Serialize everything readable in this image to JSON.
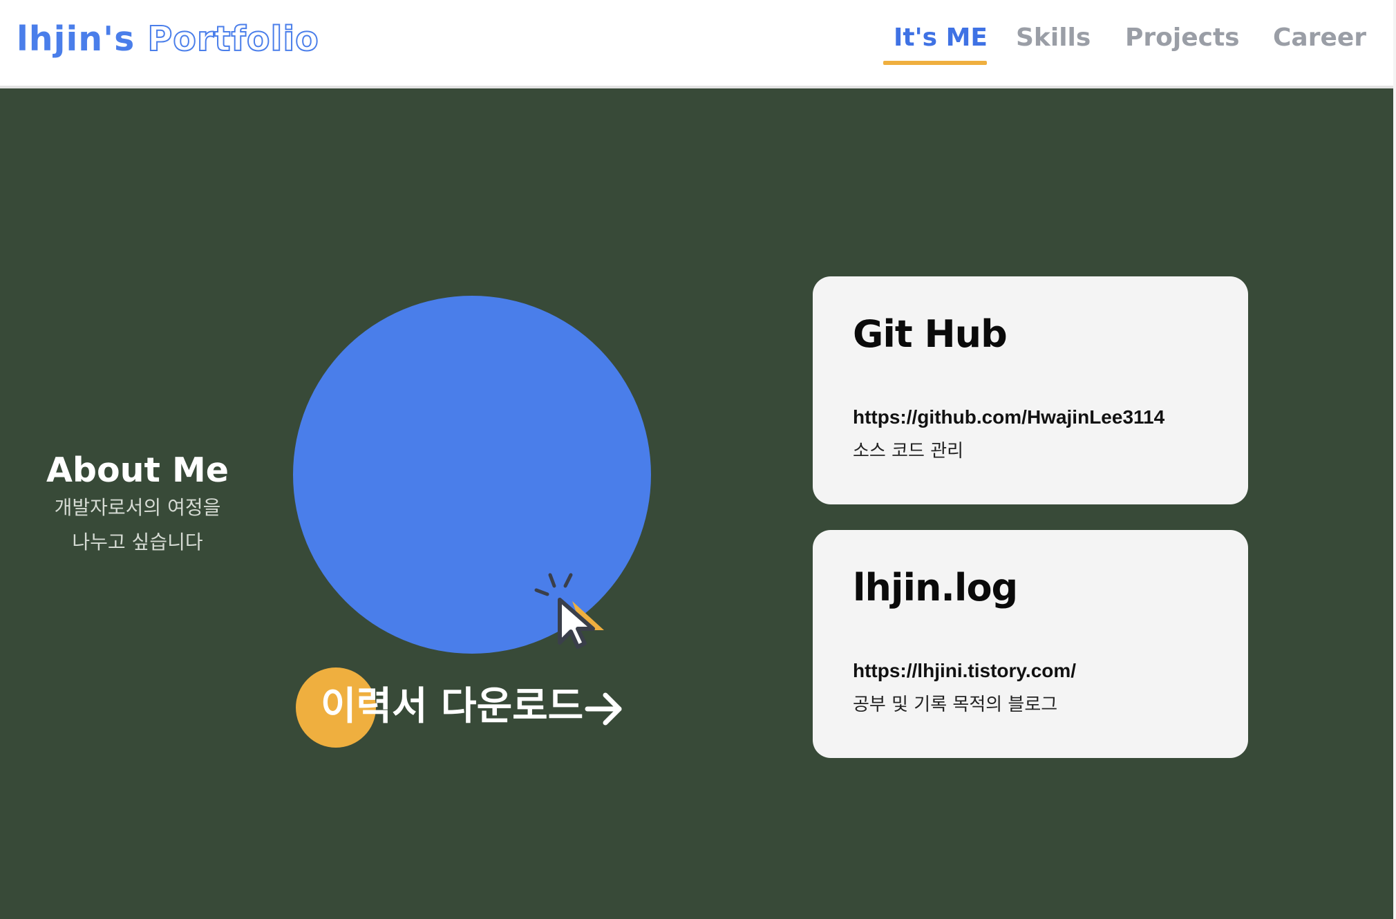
{
  "header": {
    "logo_main": "lhjin's",
    "logo_outline": "Portfolio",
    "nav": [
      {
        "label": "It's ME",
        "active": true
      },
      {
        "label": "Skills",
        "active": false
      },
      {
        "label": "Projects",
        "active": false
      },
      {
        "label": "Career",
        "active": false
      }
    ]
  },
  "about": {
    "title": "About Me",
    "subtitle_line1": "개발자로서의 여정을",
    "subtitle_line2": "나누고 싶습니다"
  },
  "download": {
    "label": "이력서 다운로드",
    "icon": "arrow-right-icon"
  },
  "cards": [
    {
      "title": "Git Hub",
      "url": "https://github.com/HwajinLee3114",
      "desc": "소스 코드 관리"
    },
    {
      "title": "lhjin.log",
      "url": "https://lhjini.tistory.com/",
      "desc": "공부 및 기록 목적의 블로그"
    }
  ],
  "colors": {
    "background": "#384a38",
    "accent_blue": "#4a7eea",
    "accent_yellow": "#efaf3f",
    "card_bg": "#f4f4f4",
    "nav_inactive": "#9a9ea6"
  }
}
